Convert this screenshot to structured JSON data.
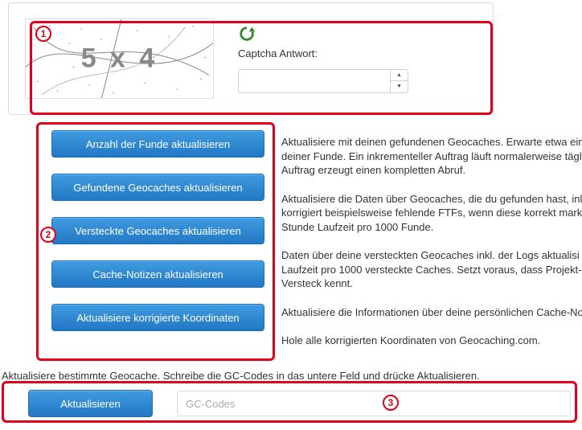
{
  "captcha": {
    "challenge_text": "5 x 4",
    "label": "Captcha Antwort:"
  },
  "buttons": [
    "Anzahl der Funde aktualisieren",
    "Gefundene Geocaches aktualisieren",
    "Versteckte Geocaches aktualisieren",
    "Cache-Notizen aktualisieren",
    "Aktualisiere korrigierte Koordinaten"
  ],
  "descriptions": [
    "Aktualisiere mit deinen gefundenen Geocaches. Erwarte etwa ein deiner Funde. Ein inkrementeller Auftrag läuft normalerweise tägli Auftrag erzeugt einen kompletten Abruf.",
    "Aktualisiere die Daten über Geocaches, die du gefunden hast, inl korrigiert beispielsweise fehlende FTFs, wenn diese korrekt marki Stunde Laufzeit pro 1000 Funde.",
    "Daten über deine versteckten Geocaches inkl. der Logs aktualisi Laufzeit pro 1000 versteckte Caches. Setzt voraus, dass Projekt- Versteck kennt.",
    "Aktualisiere die Informationen über deine persönlichen Cache-No",
    "Hole alle korrigierten Koordinaten von Geocaching.com."
  ],
  "gc_section": {
    "intro": "Aktualisiere bestimmte Geocache. Schreibe die GC-Codes in das untere Feld und drücke Aktualisieren.",
    "button_label": "Aktualisieren",
    "placeholder": "GC-Codes"
  },
  "annotations": {
    "n1": "1",
    "n2": "2",
    "n3": "3"
  }
}
